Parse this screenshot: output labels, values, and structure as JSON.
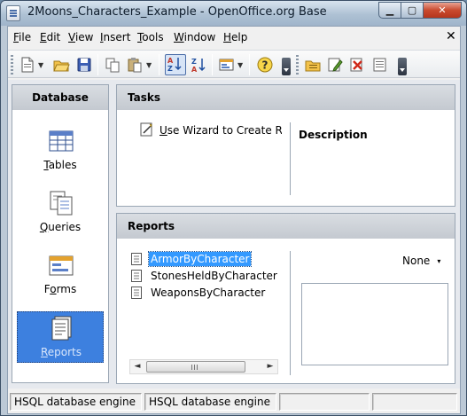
{
  "window": {
    "title": "2Moons_Characters_Example - OpenOffice.org Base",
    "controls": {
      "minimize": "▁",
      "maximize": "▢",
      "close": "✕"
    }
  },
  "menubar": {
    "items": [
      {
        "mnemonic": "F",
        "rest": "ile"
      },
      {
        "mnemonic": "E",
        "rest": "dit"
      },
      {
        "mnemonic": "V",
        "rest": "iew"
      },
      {
        "mnemonic": "I",
        "rest": "nsert"
      },
      {
        "mnemonic": "T",
        "rest": "ools"
      },
      {
        "mnemonic": "W",
        "rest": "indow"
      },
      {
        "mnemonic": "H",
        "rest": "elp"
      }
    ],
    "close_glyph": "✕"
  },
  "toolbar": {
    "icons": [
      "new-document-icon",
      "open-folder-icon",
      "save-icon",
      "copy-icon",
      "paste-icon",
      "sort-ascending-icon",
      "sort-descending-icon",
      "form-design-icon",
      "help-icon",
      "open-report-icon",
      "edit-report-icon",
      "delete-report-icon",
      "rename-report-icon"
    ],
    "dropdown_glyph": "▼"
  },
  "database": {
    "header": "Database",
    "items": [
      {
        "mnemonic": "",
        "label": "Tables",
        "underline_index": 0,
        "pre": "",
        "u": "T",
        "post": "ables"
      },
      {
        "pre": "",
        "u": "Q",
        "post": "ueries"
      },
      {
        "pre": "F",
        "u": "o",
        "post": "rms"
      },
      {
        "pre": "",
        "u": "R",
        "post": "eports"
      }
    ],
    "selected": "Reports"
  },
  "tasks": {
    "header": "Tasks",
    "wizard": {
      "pre": "",
      "u": "U",
      "post": "se Wizard to Create Report..."
    },
    "description_title": "Description"
  },
  "reports": {
    "header": "Reports",
    "items": [
      "ArmorByCharacter",
      "StonesHeldByCharacter",
      "WeaponsByCharacter"
    ],
    "selected_index": 0,
    "preview_option": "None",
    "preview_chevron": "▾",
    "scroll_left": "◄",
    "scroll_right": "►"
  },
  "statusbar": {
    "cells": [
      "HSQL database engine",
      "HSQL database engine",
      "",
      ""
    ]
  },
  "colors": {
    "selection": "#3399ff",
    "db_selected": "#3d80df",
    "panel_header": "#c4c9d0"
  }
}
